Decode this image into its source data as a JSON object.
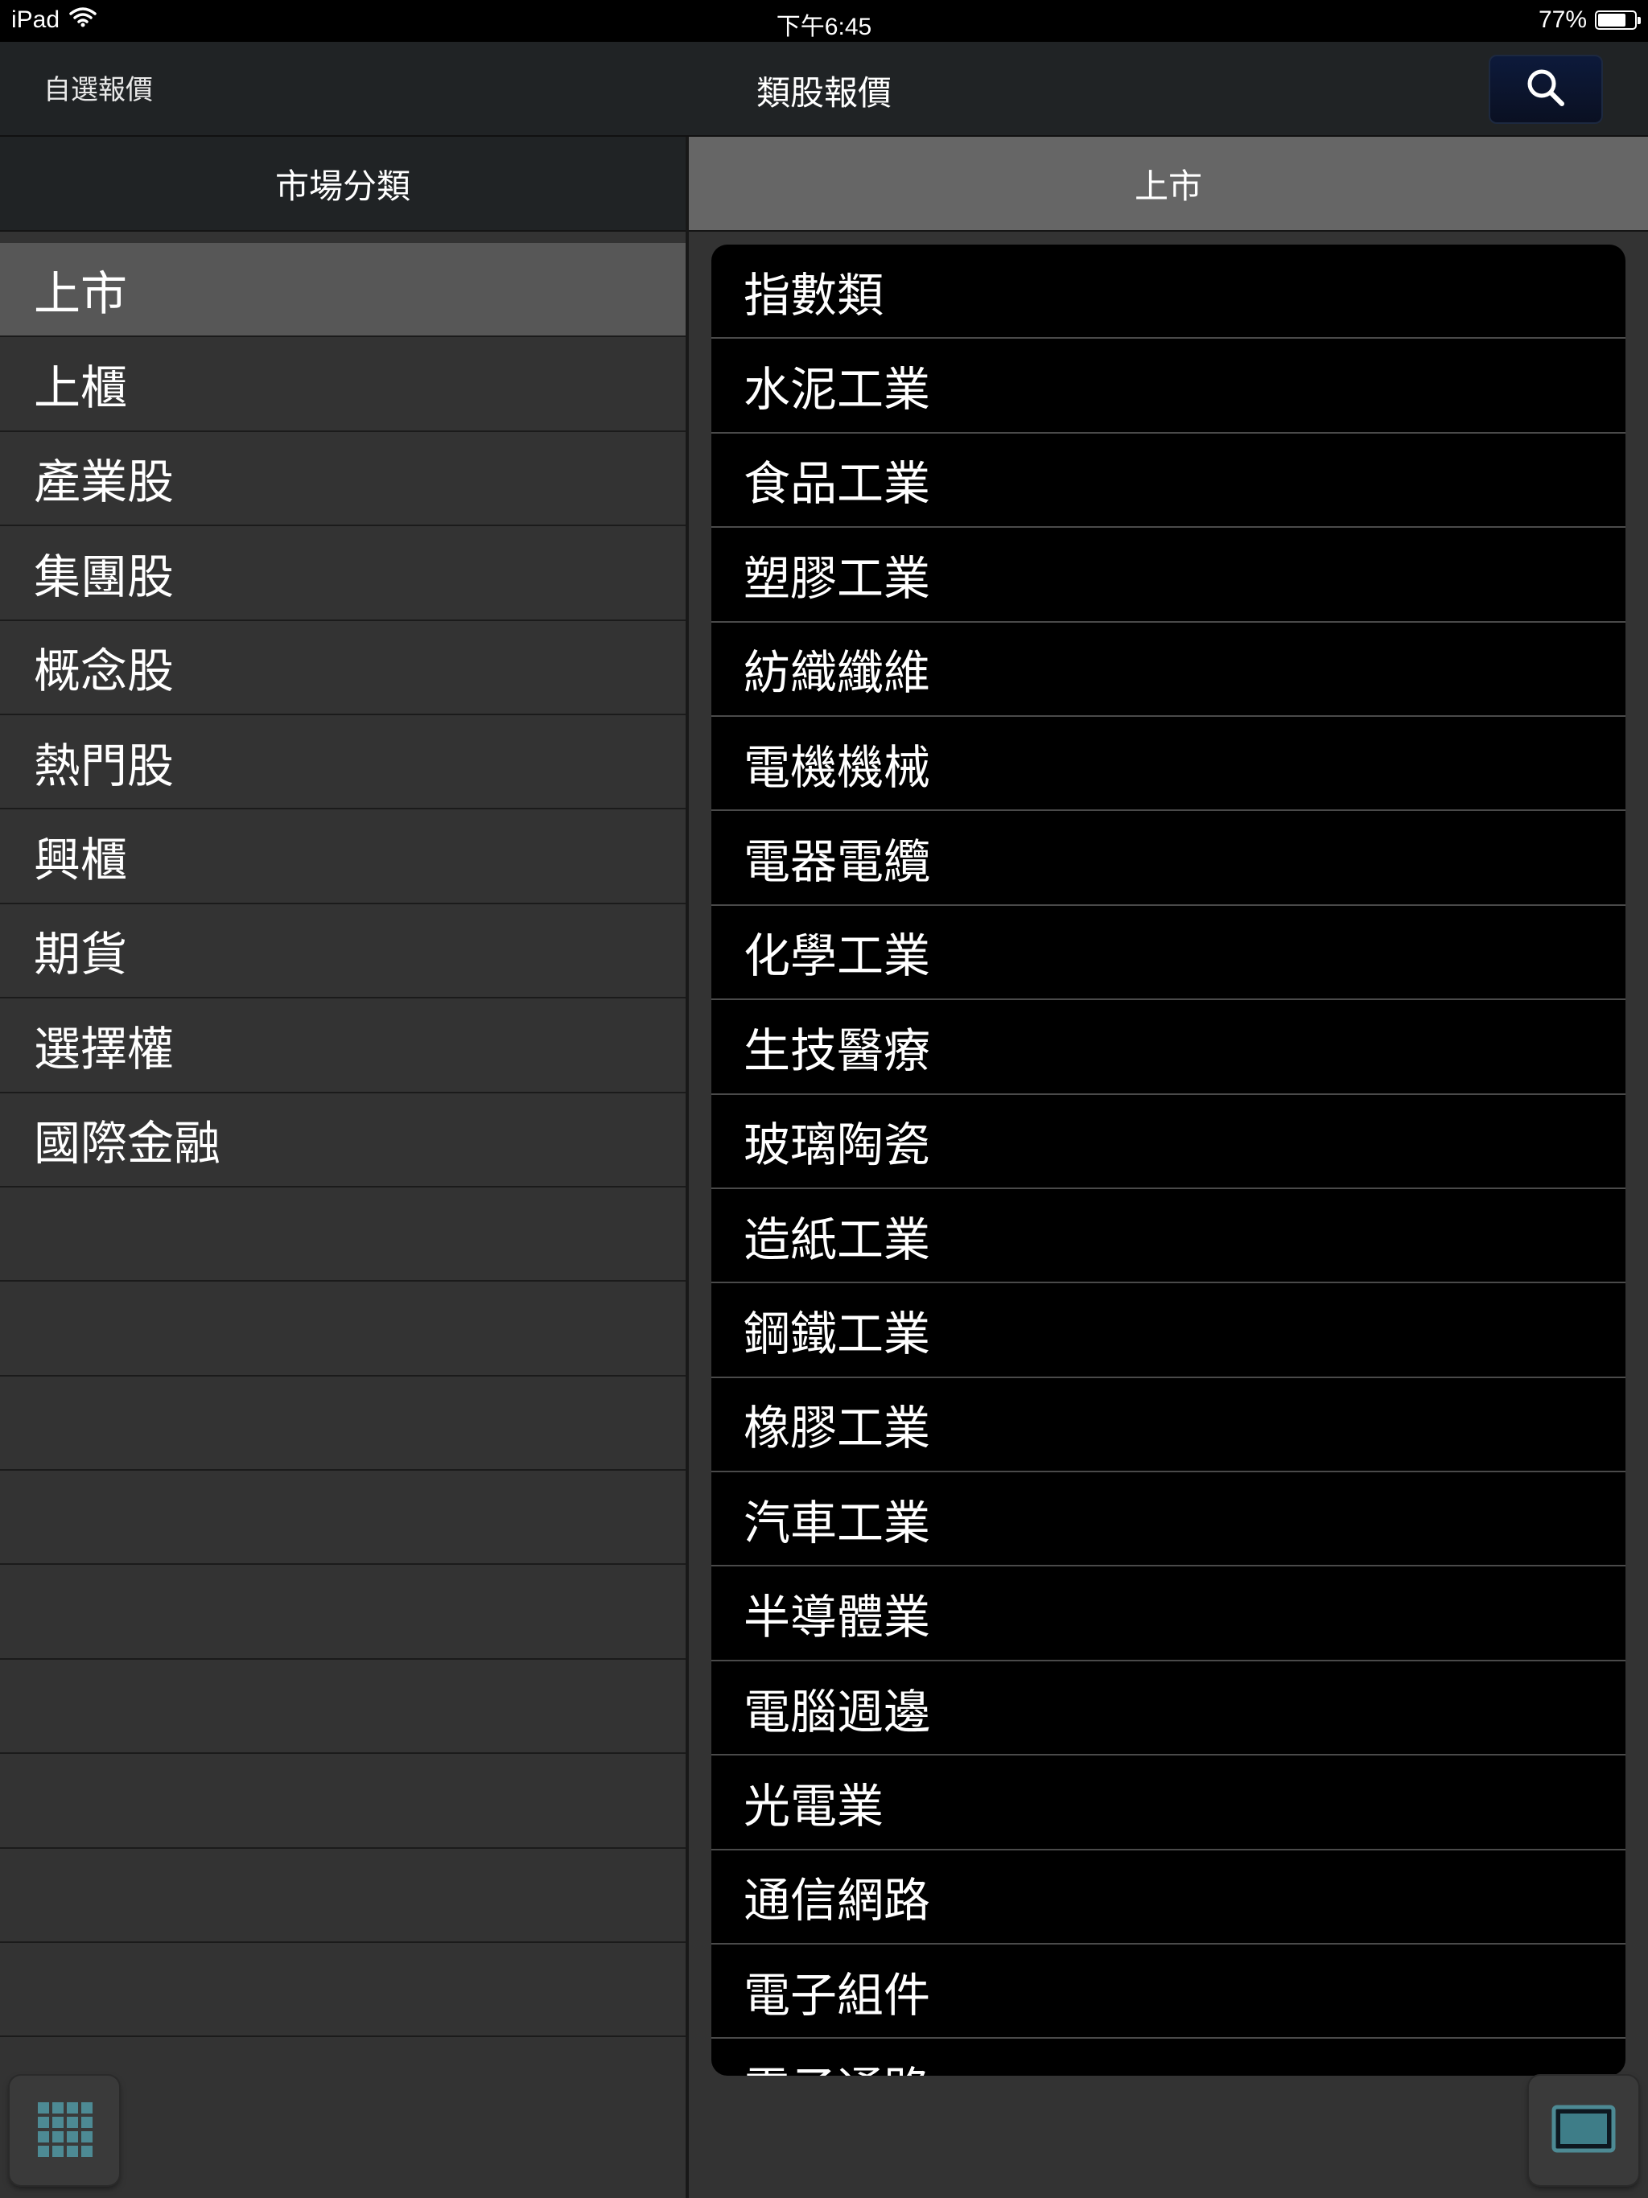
{
  "status_bar": {
    "device": "iPad",
    "time": "下午6:45",
    "battery_percent": "77%",
    "battery_level": 0.77
  },
  "nav_bar": {
    "left_label": "自選報價",
    "title": "類股報價",
    "search_icon": "search-icon"
  },
  "left_panel": {
    "header": "市場分類",
    "items": [
      {
        "label": "上市",
        "selected": true
      },
      {
        "label": "上櫃"
      },
      {
        "label": "產業股"
      },
      {
        "label": "集團股"
      },
      {
        "label": "概念股"
      },
      {
        "label": "熱門股"
      },
      {
        "label": "興櫃"
      },
      {
        "label": "期貨"
      },
      {
        "label": "選擇權"
      },
      {
        "label": "國際金融"
      }
    ],
    "empty_rows": 9
  },
  "right_panel": {
    "header": "上市",
    "items": [
      "指數類",
      "水泥工業",
      "食品工業",
      "塑膠工業",
      "紡織纖維",
      "電機機械",
      "電器電纜",
      "化學工業",
      "生技醫療",
      "玻璃陶瓷",
      "造紙工業",
      "鋼鐵工業",
      "橡膠工業",
      "汽車工業",
      "半導體業",
      "電腦週邊",
      "光電業",
      "通信網路",
      "電子組件",
      "電子通路"
    ]
  },
  "bottom": {
    "left_icon": "grid-icon",
    "right_icon": "screen-icon"
  },
  "colors": {
    "selected_row": "#575757",
    "panel_bg": "#333333",
    "right_list_bg": "#000000",
    "search_button": "#0d1a3b"
  }
}
